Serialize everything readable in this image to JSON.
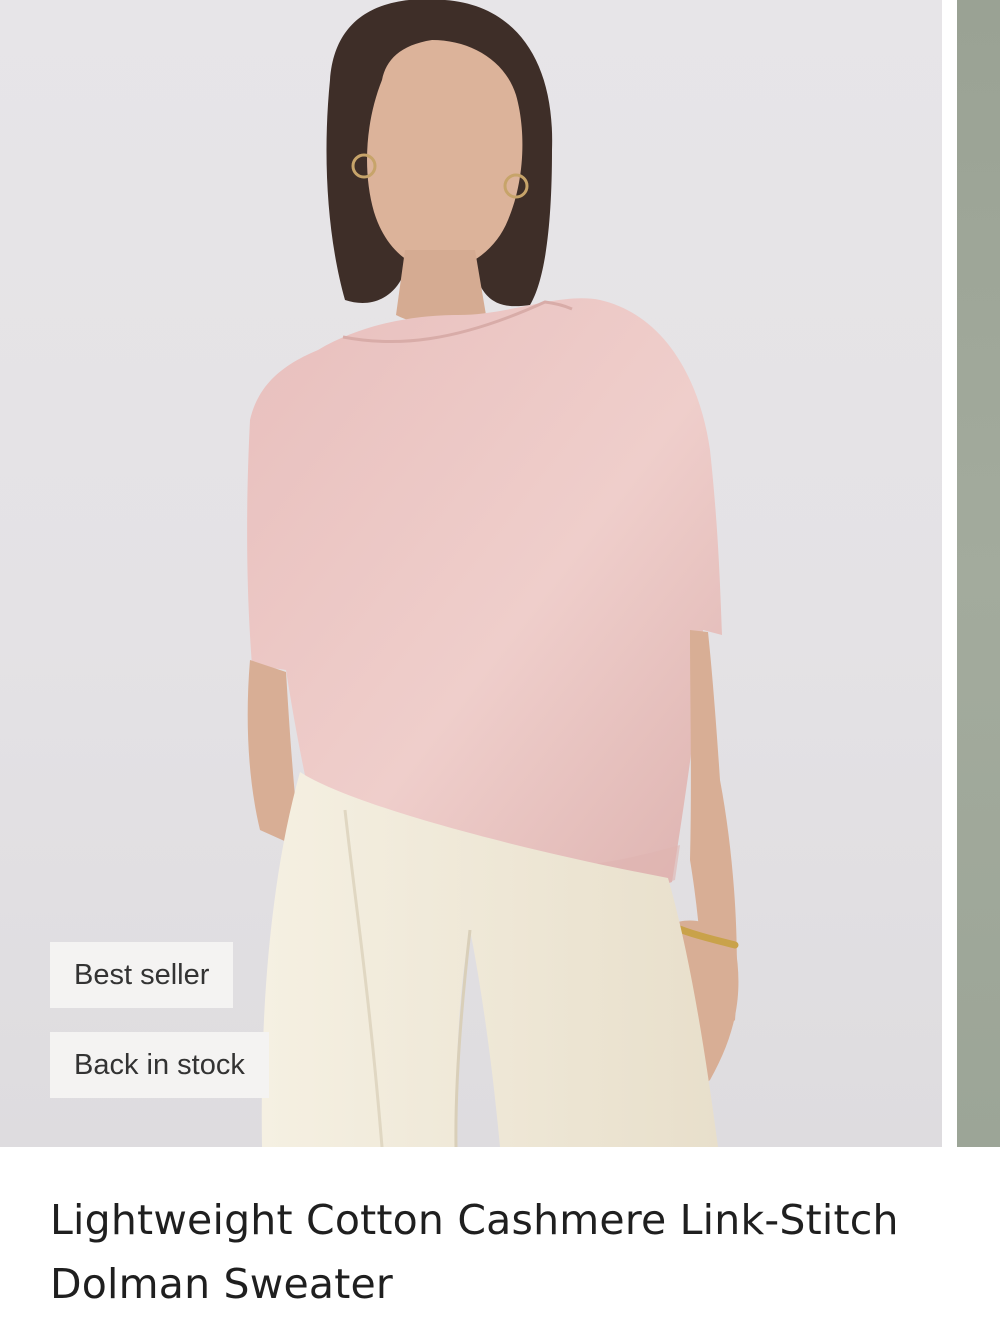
{
  "product": {
    "title": "Lightweight Cotton Cashmere Link-Stitch Dolman Sweater",
    "badges": [
      {
        "label": "Best seller"
      },
      {
        "label": "Back in stock"
      }
    ]
  },
  "colors": {
    "image_background": "#e5e3e6",
    "next_image_background": "#9fa79a",
    "sweater": "#ecc5c3",
    "pants": "#f0ead8",
    "badge_background": "#f4f3f2",
    "title_text": "#1f1f1f"
  }
}
